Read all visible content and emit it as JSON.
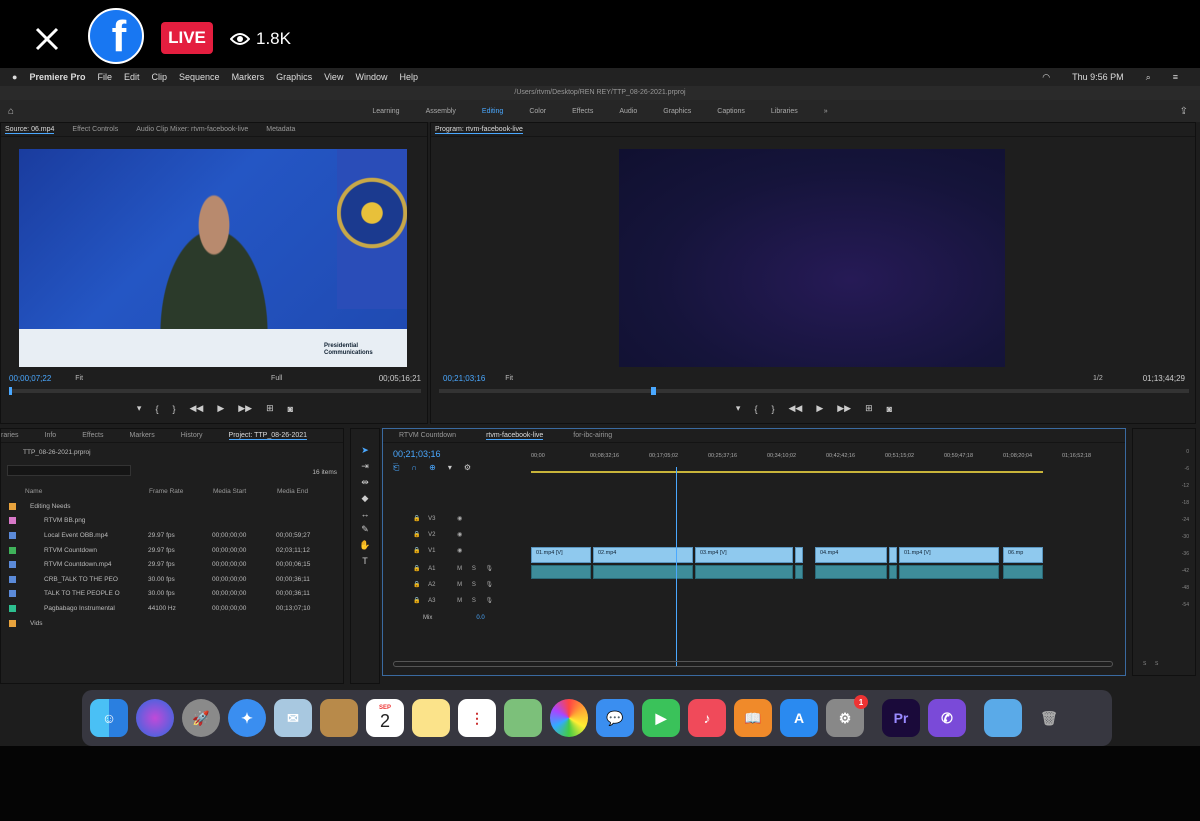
{
  "overlay": {
    "live_label": "LIVE",
    "viewer_count": "1.8K",
    "logo_letter": "f"
  },
  "menubar": {
    "app": "Premiere Pro",
    "items": [
      "File",
      "Edit",
      "Clip",
      "Sequence",
      "Markers",
      "Graphics",
      "View",
      "Window",
      "Help"
    ],
    "clock": "Thu 9:56 PM"
  },
  "titlebar": {
    "path": "/Users/rtvm/Desktop/REN REY/TTP_08-26-2021.prproj"
  },
  "workspaces": [
    "Learning",
    "Assembly",
    "Editing",
    "Color",
    "Effects",
    "Audio",
    "Graphics",
    "Captions",
    "Libraries"
  ],
  "source": {
    "tabs": [
      "Source: 06.mp4",
      "Effect Controls",
      "Audio Clip Mixer: rtvm-facebook-live",
      "Metadata"
    ],
    "timecode": "00;00;07;22",
    "fit": "Fit",
    "quality": "Full",
    "duration": "00;05;16;21",
    "watermark_line1": "Presidential",
    "watermark_line2": "Communications"
  },
  "program": {
    "tab": "Program: rtvm-facebook-live",
    "timecode": "00;21;03;16",
    "fit": "Fit",
    "quality": "1/2",
    "duration": "01;13;44;29"
  },
  "project": {
    "tabs": [
      "raries",
      "Info",
      "Effects",
      "Markers",
      "History",
      "Project: TTP_08-26-2021"
    ],
    "file": "TTP_08-26-2021.prproj",
    "count": "16 items",
    "columns": [
      "Name",
      "Frame Rate",
      "Media Start",
      "Media End"
    ],
    "rows": [
      {
        "name": "Editing Needs",
        "fr": "",
        "start": "",
        "end": "",
        "color": "#e8a33d",
        "bin": true
      },
      {
        "name": "RTVM BB.png",
        "fr": "",
        "start": "",
        "end": "",
        "color": "#d878c8"
      },
      {
        "name": "Local Event OBB.mp4",
        "fr": "29.97 fps",
        "start": "00;00;00;00",
        "end": "00;00;59;27",
        "color": "#5b8ad8"
      },
      {
        "name": "RTVM Countdown",
        "fr": "29.97 fps",
        "start": "00;00;00;00",
        "end": "02;03;11;12",
        "color": "#3fb25a"
      },
      {
        "name": "RTVM Countdown.mp4",
        "fr": "29.97 fps",
        "start": "00;00;00;00",
        "end": "00;00;06;15",
        "color": "#5b8ad8"
      },
      {
        "name": "CRB_TALK TO THE PEO",
        "fr": "30.00 fps",
        "start": "00;00;00;00",
        "end": "00;00;36;11",
        "color": "#5b8ad8"
      },
      {
        "name": "TALK TO THE PEOPLE O",
        "fr": "30.00 fps",
        "start": "00;00;00;00",
        "end": "00;00;36;11",
        "color": "#5b8ad8"
      },
      {
        "name": "Pagbabago Instrumental",
        "fr": "44100 Hz",
        "start": "00;00;00;00",
        "end": "00;13;07;10",
        "color": "#2dbf8f"
      },
      {
        "name": "Vids",
        "fr": "",
        "start": "",
        "end": "",
        "color": "#e8a33d",
        "bin": true
      }
    ]
  },
  "timeline": {
    "tabs": [
      "RTVM Countdown",
      "rtvm-facebook-live",
      "for-ibc-airing"
    ],
    "timecode": "00;21;03;16",
    "ruler": [
      "00;00",
      "00;08;32;16",
      "00;17;05;02",
      "00;25;37;16",
      "00;34;10;02",
      "00;42;42;16",
      "00;51;15;02",
      "00;59;47;18",
      "01;08;20;04",
      "01;16;52;18"
    ],
    "video_tracks": [
      "V3",
      "V2",
      "V1"
    ],
    "audio_tracks": [
      "A1",
      "A2",
      "A3"
    ],
    "mix_label": "Mix",
    "mix_value": "0.0",
    "clips": [
      "01.mp4 [V]",
      "02.mp4",
      "03.mp4 [V]",
      "04.mp4",
      "01.mp4 [V]",
      "06.mp"
    ]
  },
  "meter": {
    "ticks": [
      "0",
      "-6",
      "-12",
      "-18",
      "-24",
      "-30",
      "-36",
      "-42",
      "-48",
      "-54"
    ],
    "left": "S",
    "right": "S"
  },
  "dock": {
    "calendar_month": "SEP",
    "calendar_day": "2",
    "badge": "1",
    "pr_label": "Pr"
  },
  "colors": {
    "accent": "#4aa8ff",
    "live_red": "#e41e3f",
    "fb_blue": "#1877f2",
    "clip_video": "#8fc9ee",
    "clip_audio": "#3e8d9a"
  }
}
